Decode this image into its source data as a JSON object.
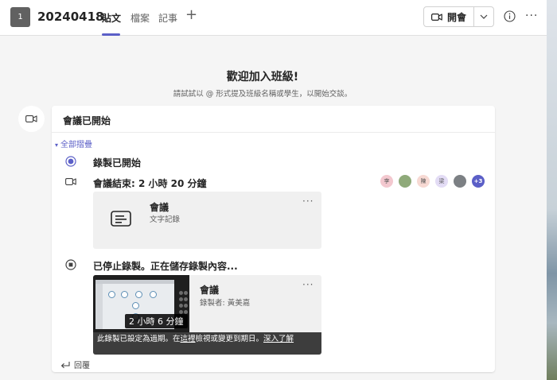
{
  "header": {
    "team_avatar": "1",
    "team_name": "20240418",
    "tabs": [
      {
        "label": "貼文",
        "active": true
      },
      {
        "label": "檔案",
        "active": false
      },
      {
        "label": "記事",
        "active": false
      }
    ],
    "add_tab_icon": "plus-icon",
    "meet_label": "開會",
    "meet_icon": "video-camera-icon",
    "dropdown_icon": "chevron-down-icon",
    "info_icon": "info-icon",
    "more_icon": "more-horizontal-icon"
  },
  "welcome": {
    "title": "歡迎加入班級!",
    "subtitle": "請試試以 @ 形式提及班級名稱或學生，以開始交談。"
  },
  "post": {
    "title": "會議已開始",
    "collapse_label": "全部摺疊",
    "rows": {
      "recording_started": "錄製已開始",
      "meeting_ended": "會議結束: 2 小時 20 分鐘",
      "recording_stopped": "已停止錄製。正在儲存錄製內容..."
    },
    "participants": {
      "avatars": [
        "李",
        "",
        "陳",
        "梁",
        ""
      ],
      "overflow": "+3"
    },
    "transcript_card": {
      "title": "會議",
      "subtitle": "文字記錄",
      "more": "···"
    },
    "recording_card": {
      "title": "會議",
      "subtitle": "錄製者: 黃美嘉",
      "duration": "2 小時 6 分鐘",
      "more": "···",
      "expiry_prefix": "此錄製已設定為過期。在",
      "expiry_link_here": "這裡",
      "expiry_middle": "檢視或變更到期日。",
      "expiry_learn_more": "深入了解"
    },
    "reply_label": "回覆"
  },
  "colors": {
    "accent": "#5b5fc7",
    "background": "#f5f5f5",
    "card": "#ffffff"
  }
}
